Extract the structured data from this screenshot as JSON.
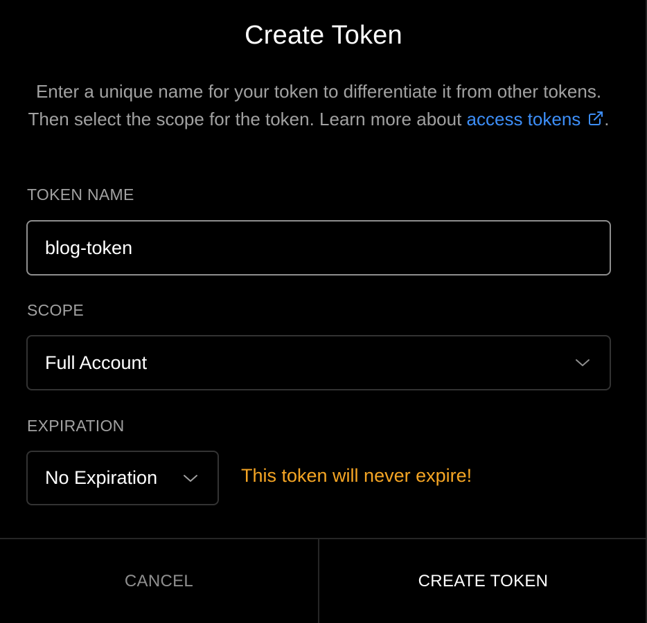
{
  "dialog": {
    "title": "Create Token",
    "description_before_link": "Enter a unique name for your token to differentiate it from other tokens. Then select the scope for the token. Learn more about ",
    "link_text": "access tokens",
    "description_after_link": ".",
    "link_icon": "external-link-icon"
  },
  "token_name": {
    "label": "TOKEN NAME",
    "value": "blog-token"
  },
  "scope": {
    "label": "SCOPE",
    "selected": "Full Account",
    "icon": "chevron-down-icon"
  },
  "expiration": {
    "label": "EXPIRATION",
    "selected": "No Expiration",
    "icon": "chevron-down-icon",
    "warning": "This token will never expire!",
    "warning_color": "#f5a524"
  },
  "footer": {
    "cancel_label": "CANCEL",
    "create_label": "CREATE TOKEN"
  },
  "colors": {
    "background": "#000000",
    "link": "#3d8ef7",
    "muted_text": "#a1a1a1"
  }
}
